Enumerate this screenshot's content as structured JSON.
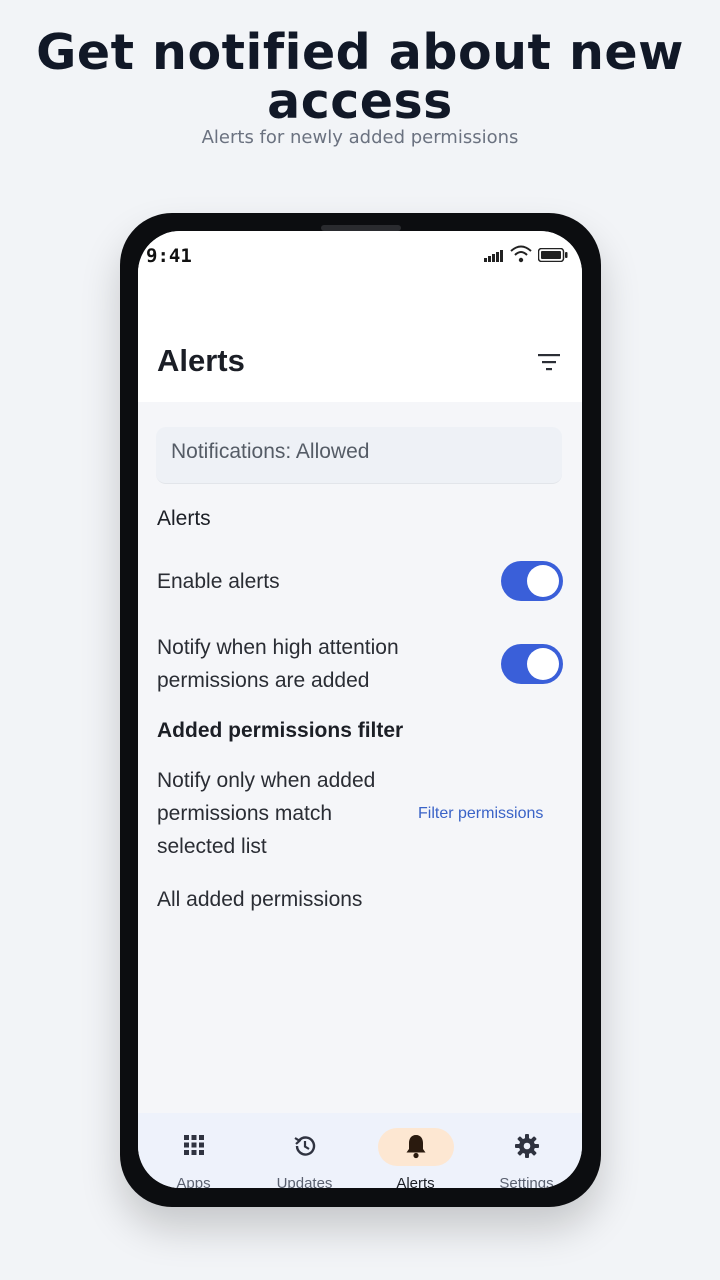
{
  "promo": {
    "headline": "Get notified about new access",
    "subheadline": "Alerts for newly added permissions"
  },
  "status_bar": {
    "time": "9:41"
  },
  "app_bar": {
    "title": "Alerts",
    "filter_icon": "filter-list-icon"
  },
  "notifications_card": {
    "text": "Notifications: Allowed"
  },
  "alerts_section": {
    "heading": "Alerts",
    "enable_alerts": {
      "label": "Enable alerts",
      "on": true
    },
    "notify_high_attention": {
      "label_line1": "Notify when high attention",
      "label_line2": "permissions are added",
      "on": true
    }
  },
  "filter_section": {
    "heading": "Added permissions filter",
    "description_line1": "Notify only when added",
    "description_line2": "permissions match",
    "description_line3": "selected list",
    "link": "Filter permissions",
    "current_value": "All added permissions"
  },
  "bottom_nav": {
    "items": [
      {
        "label": "Apps",
        "icon": "grid-icon"
      },
      {
        "label": "Updates",
        "icon": "history-icon"
      },
      {
        "label": "Alerts",
        "icon": "bell-icon",
        "active": true
      },
      {
        "label": "Settings",
        "icon": "gear-icon"
      }
    ]
  },
  "colors": {
    "accent": "#3a5fd9",
    "active_nav_pill": "#fde7d2",
    "link": "#3a63c7"
  }
}
